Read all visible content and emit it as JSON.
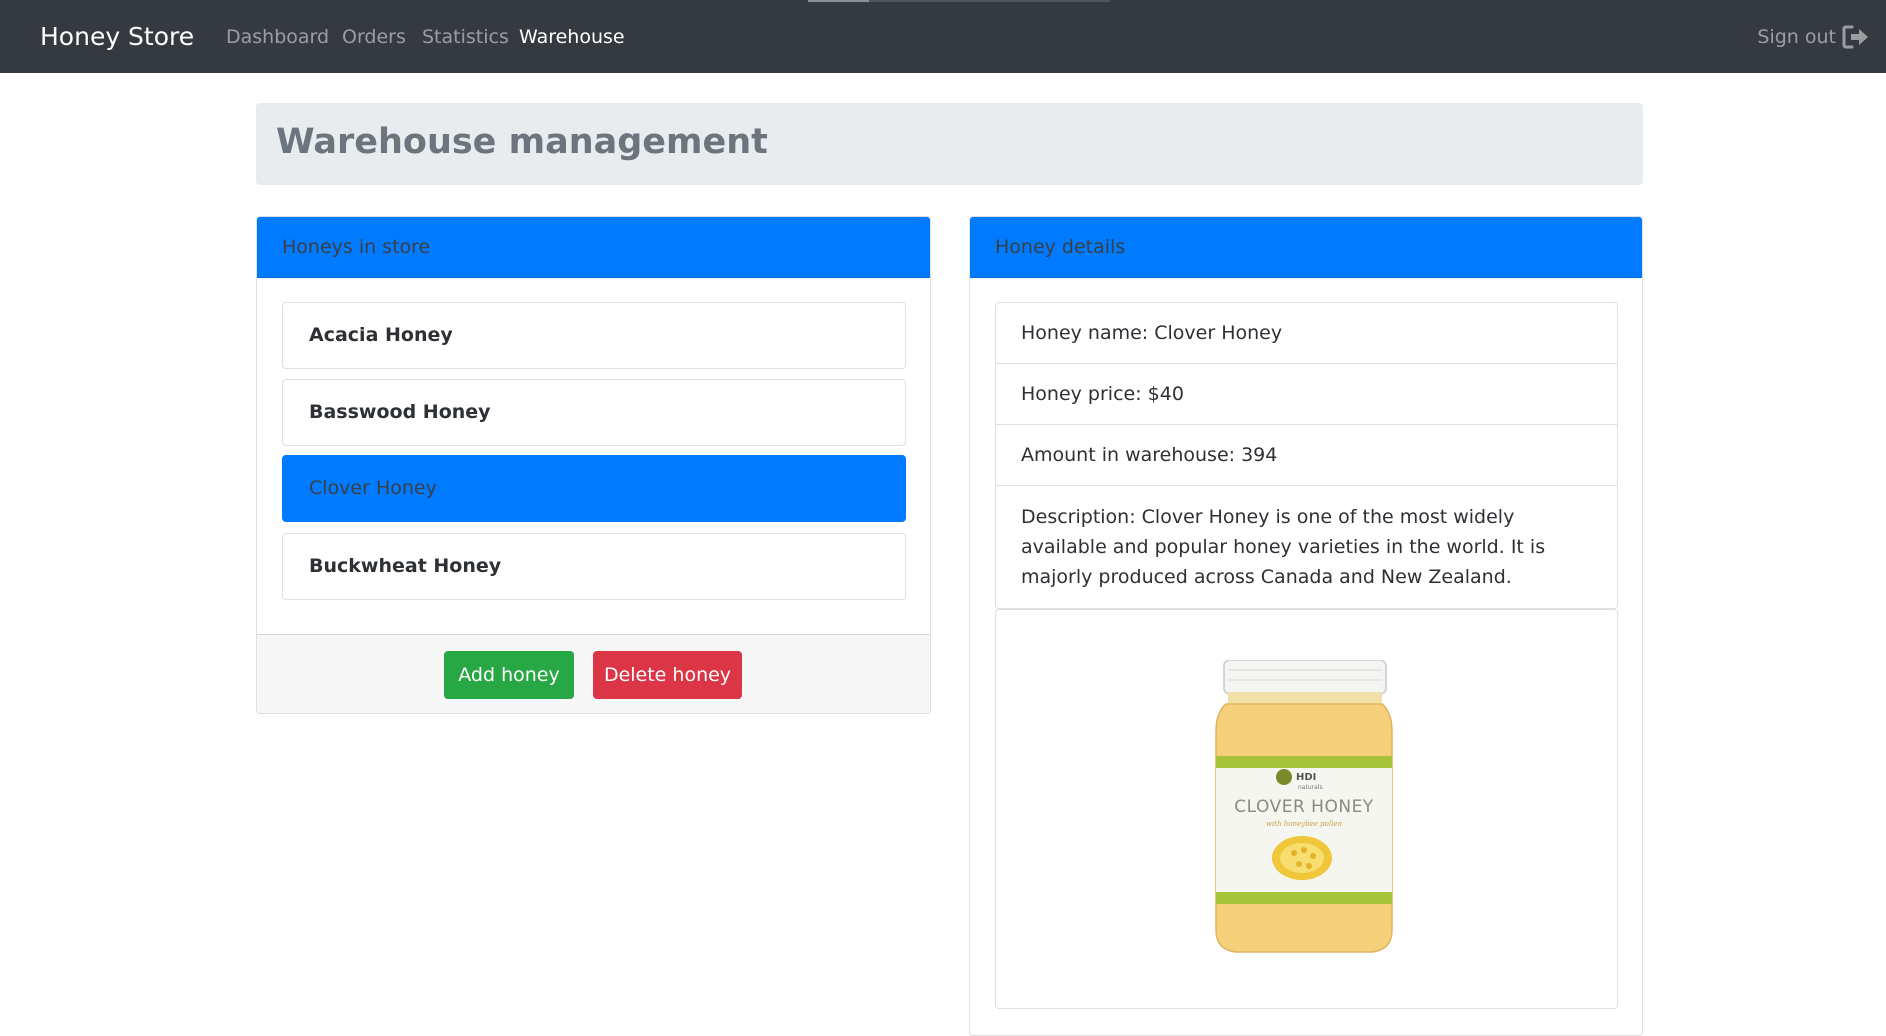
{
  "navbar": {
    "brand": "Honey Store",
    "links": [
      {
        "label": "Dashboard"
      },
      {
        "label": "Orders"
      },
      {
        "label": "Statistics"
      },
      {
        "label": "Warehouse",
        "active": true
      }
    ],
    "signout_label": "Sign out",
    "signout_icon": "sign-out-icon"
  },
  "page": {
    "title": "Warehouse management"
  },
  "honeys_card": {
    "header": "Honeys in store",
    "items": [
      {
        "label": "Acacia Honey"
      },
      {
        "label": "Basswood Honey"
      },
      {
        "label": "Clover Honey",
        "selected": true
      },
      {
        "label": "Buckwheat Honey"
      }
    ],
    "add_button": "Add honey",
    "delete_button": "Delete honey"
  },
  "details_card": {
    "header": "Honey details",
    "name": "Honey name: Clover Honey",
    "price": "Honey price: $40",
    "amount": "Amount in warehouse: 394",
    "description": "Description: Clover Honey is one of the most widely available and popular honey varieties in the world. It is majorly produced across Canada and New Zealand.",
    "image": {
      "icon": "honey-jar-image",
      "label_brand": "HDI naturals",
      "label_title": "CLOVER HONEY",
      "label_subtitle": "with honeybee pollen"
    }
  },
  "colors": {
    "navbar_bg": "#343a40",
    "primary": "#007bff",
    "success": "#28a745",
    "danger": "#dc3545",
    "jumbotron_bg": "#e9ecef"
  }
}
